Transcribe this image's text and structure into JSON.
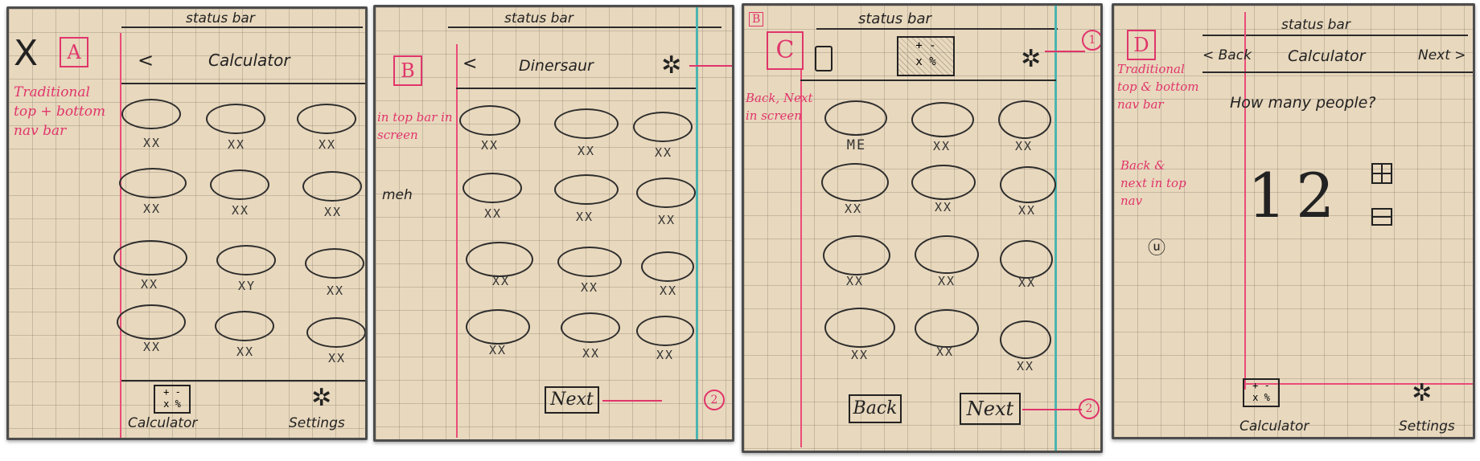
{
  "panels": {
    "a": {
      "status": "status bar",
      "back": "<",
      "title": "Calculator",
      "letter": "A",
      "cross": "X",
      "note": "Traditional top + bottom nav bar",
      "labels": [
        "XX",
        "XX",
        "XX",
        "XX",
        "XX",
        "XX",
        "XX",
        "XY",
        "XX",
        "XX",
        "XX",
        "XX"
      ],
      "tab_calc": "Calculator",
      "tab_settings": "Settings",
      "calc_glyph": "+ -\nx %"
    },
    "b": {
      "status": "status bar",
      "back": "<",
      "title": "Dinersaur",
      "letter": "B",
      "note": "in top bar in screen",
      "meh": "meh",
      "labels": [
        "XX",
        "XX",
        "XX",
        "XX",
        "XX",
        "XX",
        "XX",
        "XX",
        "XX",
        "XX",
        "XX",
        "XX"
      ],
      "next": "Next",
      "ann": "2"
    },
    "c": {
      "status": "status bar",
      "letter": "C",
      "small_letter": "B",
      "note": "Back, Next in screen",
      "labels": [
        "ME",
        "XX",
        "XX",
        "XX",
        "XX",
        "XX",
        "XX",
        "XX",
        "XX",
        "XX",
        "XX",
        "XX"
      ],
      "back": "Back",
      "next": "Next",
      "ann1": "1",
      "ann2": "2",
      "calc_glyph": "+ -\nx %"
    },
    "d": {
      "status": "status bar",
      "back": "< Back",
      "title": "Calculator",
      "next": "Next >",
      "letter": "D",
      "note1": "Traditional top & bottom nav bar",
      "note2": "Back & next in top nav",
      "question": "How many people?",
      "n1": "1",
      "n2": "2",
      "tab_calc": "Calculator",
      "tab_settings": "Settings",
      "calc_glyph": "+ -\nx %"
    }
  }
}
